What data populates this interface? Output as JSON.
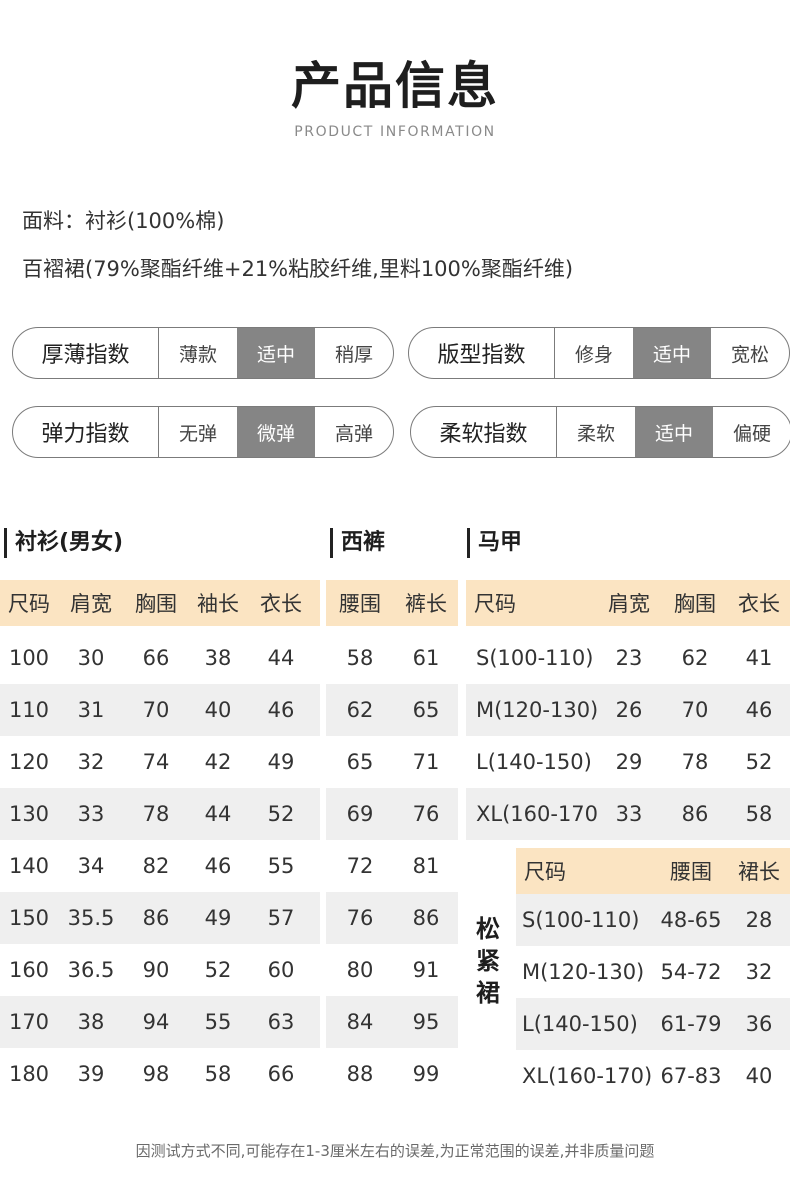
{
  "header": {
    "title_cn": "产品信息",
    "title_en": "PRODUCT INFORMATION"
  },
  "materials": {
    "line1": "面料：衬衫(100%棉)",
    "line2": "百褶裙(79%聚酯纤维+21%粘胶纤维,里料100%聚酯纤维)"
  },
  "indices": [
    {
      "name": "厚薄指数",
      "options": [
        "薄款",
        "适中",
        "稍厚"
      ],
      "selected": 1
    },
    {
      "name": "版型指数",
      "options": [
        "修身",
        "适中",
        "宽松"
      ],
      "selected": 1
    },
    {
      "name": "弹力指数",
      "options": [
        "无弹",
        "微弹",
        "高弹"
      ],
      "selected": 1
    },
    {
      "name": "柔软指数",
      "options": [
        "柔软",
        "适中",
        "偏硬"
      ],
      "selected": 1
    }
  ],
  "colors": {
    "header_bg": "#fbe4c2",
    "row_alt": "#efefef",
    "selected_bg": "#858585"
  },
  "shirt": {
    "title": "衬衫(男女)",
    "headers": [
      "尺码",
      "肩宽",
      "胸围",
      "袖长",
      "衣长"
    ],
    "rows": [
      [
        "100",
        "30",
        "66",
        "38",
        "44"
      ],
      [
        "110",
        "31",
        "70",
        "40",
        "46"
      ],
      [
        "120",
        "32",
        "74",
        "42",
        "49"
      ],
      [
        "130",
        "33",
        "78",
        "44",
        "52"
      ],
      [
        "140",
        "34",
        "82",
        "46",
        "55"
      ],
      [
        "150",
        "35.5",
        "86",
        "49",
        "57"
      ],
      [
        "160",
        "36.5",
        "90",
        "52",
        "60"
      ],
      [
        "170",
        "38",
        "94",
        "55",
        "63"
      ],
      [
        "180",
        "39",
        "98",
        "58",
        "66"
      ]
    ]
  },
  "trousers": {
    "title": "西裤",
    "headers": [
      "腰围",
      "裤长"
    ],
    "rows": [
      [
        "58",
        "61"
      ],
      [
        "62",
        "65"
      ],
      [
        "65",
        "71"
      ],
      [
        "69",
        "76"
      ],
      [
        "72",
        "81"
      ],
      [
        "76",
        "86"
      ],
      [
        "80",
        "91"
      ],
      [
        "84",
        "95"
      ],
      [
        "88",
        "99"
      ]
    ]
  },
  "vest": {
    "title": "马甲",
    "headers": [
      "尺码",
      "肩宽",
      "胸围",
      "衣长"
    ],
    "rows": [
      [
        "S(100-110)",
        "23",
        "62",
        "41"
      ],
      [
        "M(120-130)",
        "26",
        "70",
        "46"
      ],
      [
        "L(140-150)",
        "29",
        "78",
        "52"
      ],
      [
        "XL(160-170)",
        "33",
        "86",
        "58"
      ]
    ]
  },
  "skirt": {
    "title": "松紧裙",
    "headers": [
      "尺码",
      "腰围",
      "裙长"
    ],
    "rows": [
      [
        "S(100-110)",
        "48-65",
        "28"
      ],
      [
        "M(120-130)",
        "54-72",
        "32"
      ],
      [
        "L(140-150)",
        "61-79",
        "36"
      ],
      [
        "XL(160-170)",
        "67-83",
        "40"
      ]
    ]
  },
  "note": "因测试方式不同,可能存在1-3厘米左右的误差,为正常范围的误差,并非质量问题"
}
